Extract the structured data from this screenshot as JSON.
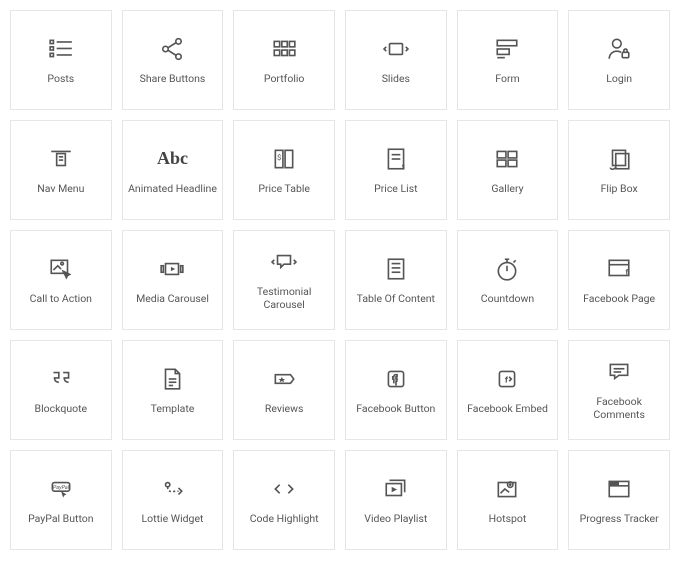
{
  "widgets": [
    {
      "id": "posts",
      "label": "Posts"
    },
    {
      "id": "share-buttons",
      "label": "Share Buttons"
    },
    {
      "id": "portfolio",
      "label": "Portfolio"
    },
    {
      "id": "slides",
      "label": "Slides"
    },
    {
      "id": "form",
      "label": "Form"
    },
    {
      "id": "login",
      "label": "Login"
    },
    {
      "id": "nav-menu",
      "label": "Nav Menu"
    },
    {
      "id": "animated-headline",
      "label": "Animated Headline"
    },
    {
      "id": "price-table",
      "label": "Price Table"
    },
    {
      "id": "price-list",
      "label": "Price List"
    },
    {
      "id": "gallery",
      "label": "Gallery"
    },
    {
      "id": "flip-box",
      "label": "Flip Box"
    },
    {
      "id": "call-to-action",
      "label": "Call to Action"
    },
    {
      "id": "media-carousel",
      "label": "Media Carousel"
    },
    {
      "id": "testimonial-carousel",
      "label": "Testimonial Carousel"
    },
    {
      "id": "table-of-content",
      "label": "Table Of Content"
    },
    {
      "id": "countdown",
      "label": "Countdown"
    },
    {
      "id": "facebook-page",
      "label": "Facebook Page"
    },
    {
      "id": "blockquote",
      "label": "Blockquote"
    },
    {
      "id": "template",
      "label": "Template"
    },
    {
      "id": "reviews",
      "label": "Reviews"
    },
    {
      "id": "facebook-button",
      "label": "Facebook Button"
    },
    {
      "id": "facebook-embed",
      "label": "Facebook Embed"
    },
    {
      "id": "facebook-comments",
      "label": "Facebook Comments"
    },
    {
      "id": "paypal-button",
      "label": "PayPal Button"
    },
    {
      "id": "lottie-widget",
      "label": "Lottie Widget"
    },
    {
      "id": "code-highlight",
      "label": "Code Highlight"
    },
    {
      "id": "video-playlist",
      "label": "Video Playlist"
    },
    {
      "id": "hotspot",
      "label": "Hotspot"
    },
    {
      "id": "progress-tracker",
      "label": "Progress Tracker"
    }
  ]
}
